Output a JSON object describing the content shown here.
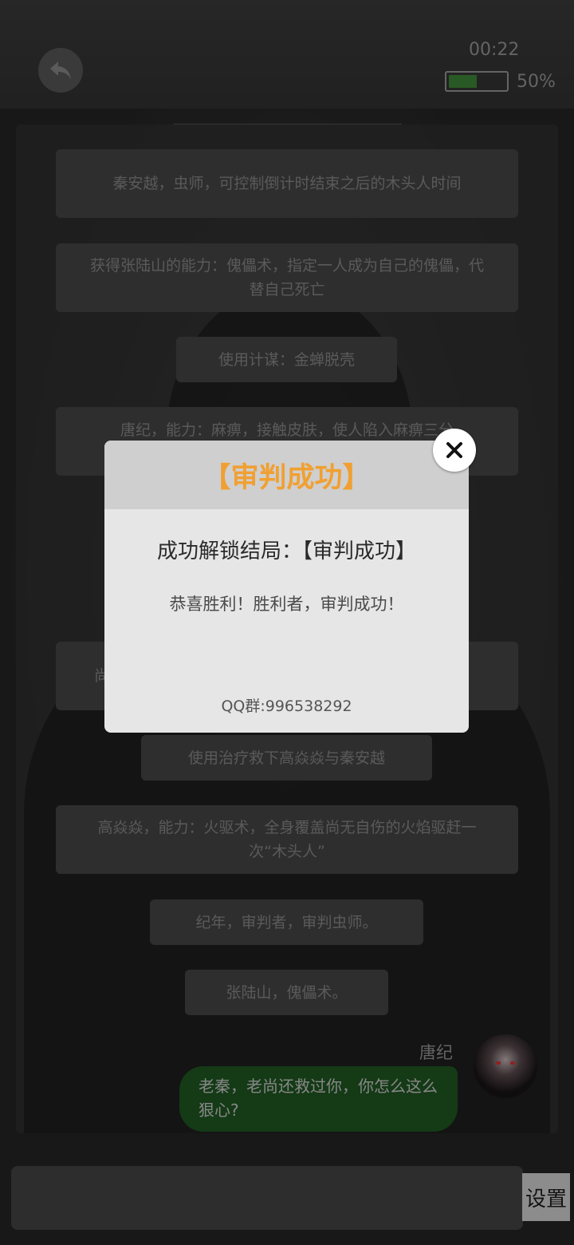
{
  "status": {
    "timer": "00:22",
    "battery_percent_label": "50%",
    "battery_level": 0.5
  },
  "messages": [
    "秦安越，虫师，可控制倒计时结束之后的木头人时间",
    "获得张陆山的能力：傀儡术，指定一人成为自己的傀儡，代替自己死亡",
    "使用计谋：金蝉脱壳",
    "唐纪，能力：麻痹，接触皮肤，使人陷入麻痹三分",
    "尚",
    "使用治疗救下高焱焱与秦安越",
    "高焱焱，能力：火驱术，全身覆盖尚无自伤的火焰驱赶一次“木头人”",
    "纪年，审判者，审判虫师。",
    "张陆山，傀儡术。"
  ],
  "chat": {
    "speaker": "唐纪",
    "text": "老秦，老尚还救过你，你怎么这么狠心?"
  },
  "input": {
    "placeholder": ""
  },
  "settings_label": "设置",
  "modal": {
    "title": "【审判成功】",
    "subtitle": "成功解锁结局：【审判成功】",
    "body": "恭喜胜利！胜利者，审判成功！",
    "footer": "QQ群:996538292"
  },
  "colors": {
    "title": "#f0a032",
    "bubble": "#1f5a22",
    "battery": "#3f8a3a"
  },
  "icons": {
    "back": "back-arrow-icon",
    "close": "close-icon",
    "avatar": "avatar-icon"
  }
}
